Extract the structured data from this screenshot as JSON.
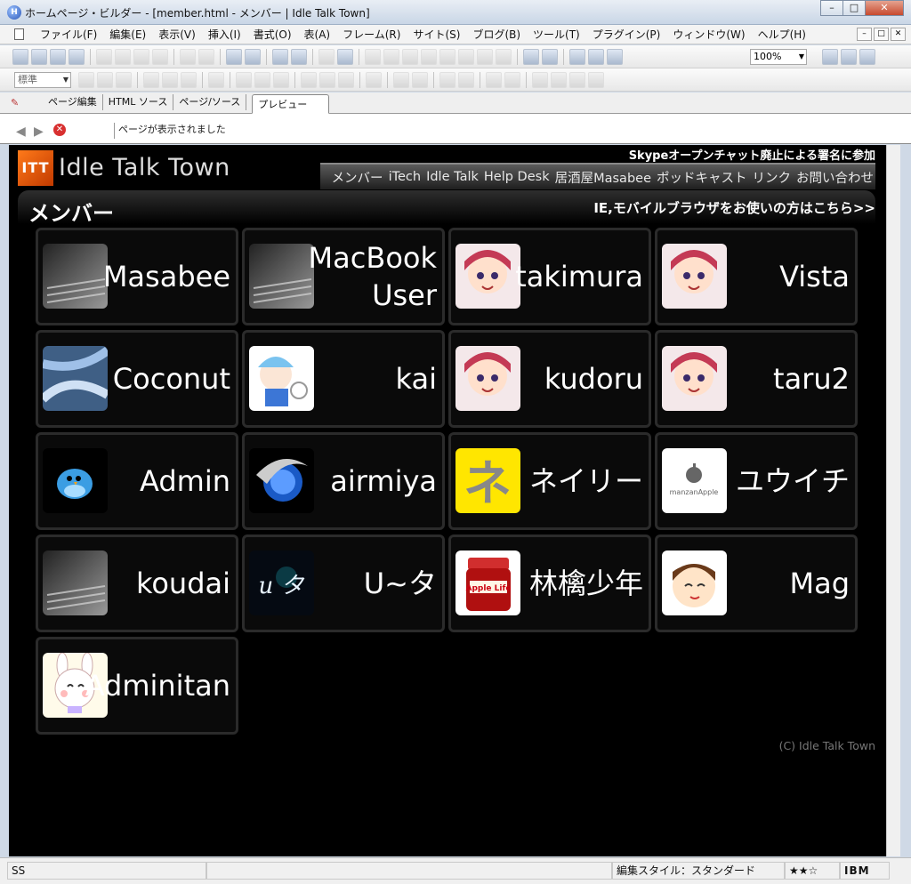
{
  "window": {
    "title": "ホームページ・ビルダー - [member.html - メンバー | Idle Talk Town]",
    "min_label": "–",
    "max_label": "□",
    "close_label": "✕"
  },
  "menu": [
    "ファイル(F)",
    "編集(E)",
    "表示(V)",
    "挿入(I)",
    "書式(O)",
    "表(A)",
    "フレーム(R)",
    "サイト(S)",
    "ブログ(B)",
    "ツール(T)",
    "プラグイン(P)",
    "ウィンドウ(W)",
    "ヘルプ(H)"
  ],
  "toolbar": {
    "zoom": "100%",
    "style": "標準"
  },
  "tabs": [
    "ページ編集",
    "HTML ソース",
    "ページ/ソース",
    "プレビュー"
  ],
  "nav": {
    "status": "ページが表示されました"
  },
  "site": {
    "logo_mark": "ITT",
    "logo_text": "Idle Talk Town",
    "notice": "Skypeオープンチャット廃止による署名に参加",
    "nav_items": [
      "メンバー",
      "iTech",
      "Idle Talk",
      "Help Desk",
      "居酒屋Masabee",
      "ポッドキャスト",
      "リンク",
      "お問い合わせ"
    ],
    "section_title": "メンバー",
    "section_link": "IE,モバイルブラウザをお使いの方はこちら>>",
    "copyright": "(C) Idle Talk Town"
  },
  "members": [
    {
      "name": "Masabee",
      "icon": "keyboard-icon"
    },
    {
      "name": "MacBook User",
      "icon": "keyboard-icon"
    },
    {
      "name": "takimura",
      "icon": "anime-girl-icon"
    },
    {
      "name": "Vista",
      "icon": "anime-girl-icon"
    },
    {
      "name": "Coconut",
      "icon": "abstract-logo-icon"
    },
    {
      "name": "kai",
      "icon": "cirno-icon"
    },
    {
      "name": "kudoru",
      "icon": "anime-girl-icon"
    },
    {
      "name": "taru2",
      "icon": "anime-girl-icon"
    },
    {
      "name": "Admin",
      "icon": "bird-icon"
    },
    {
      "name": "airmiya",
      "icon": "swirl-logo-icon"
    },
    {
      "name": "ネイリー",
      "icon": "ne-letter-icon"
    },
    {
      "name": "ユウイチ",
      "icon": "apple-logo-icon"
    },
    {
      "name": "koudai",
      "icon": "keyboard-icon"
    },
    {
      "name": "U~タ",
      "icon": "sparkle-logo-icon"
    },
    {
      "name": "林檎少年",
      "icon": "jam-jar-icon"
    },
    {
      "name": "Mag",
      "icon": "face-icon"
    },
    {
      "name": "Adminitan",
      "icon": "rabbit-icon"
    }
  ],
  "thumb_text": {
    "ne": "ネ",
    "manzan": "manzanApple",
    "u_logo": "u タ",
    "jam": "Apple Life"
  },
  "statusbar": {
    "left": "SS",
    "style": "編集スタイル：スタンダード",
    "stars": "★★☆",
    "brand": "IBM"
  }
}
